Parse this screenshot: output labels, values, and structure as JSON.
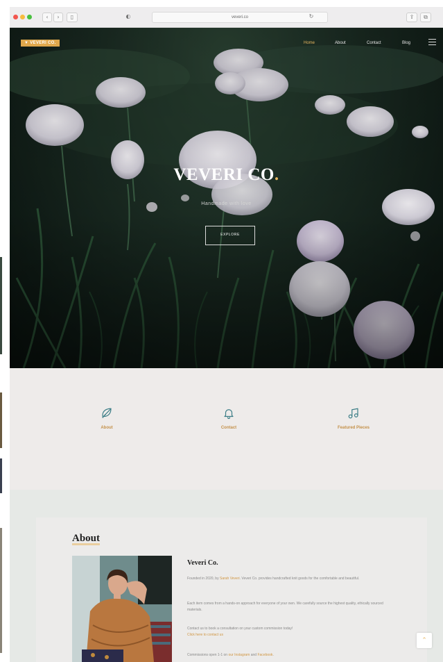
{
  "browser": {
    "url": "veveri.co",
    "colors": {
      "close": "#f2564f",
      "minimize": "#f7bb3e",
      "maximize": "#49c03f"
    },
    "icons": [
      "back-icon",
      "forward-icon",
      "sidebar-icon",
      "privacy-icon",
      "reload-icon",
      "share-icon",
      "tabs-icon"
    ]
  },
  "nav": {
    "logo": "VEVERI CO.",
    "items": [
      "Home",
      "About",
      "Contact",
      "Blog"
    ],
    "active_index": 0
  },
  "hero": {
    "title_main": "VEVERI",
    "title_tail": " CO",
    "title_dot": ".",
    "subtitle": "Handmade with love",
    "button": "EXPLORE"
  },
  "features": [
    {
      "icon": "leaf-icon",
      "label": "About"
    },
    {
      "icon": "bell-icon",
      "label": "Contact"
    },
    {
      "icon": "music-icon",
      "label": "Featured Pieces"
    }
  ],
  "about": {
    "heading": "About",
    "name": "Veveri Co.",
    "p1_before": "Founded in 2020, by ",
    "p1_link": "Sarah Veveri",
    "p1_after": ". Veveri Co. provides handcrafted knit goods for the comfortable and beautiful.",
    "p2": "Each item comes from a hands-on approach for everyone of your own. We carefully source the highest quality, ethically sourced materials.",
    "p3": "Contact us to book a consultation on your custom commission today!",
    "p3_link": "Click here to contact us",
    "p4_before": "Commissions open 1-1 on ",
    "p4_link1": "our Instagram",
    "p4_mid": " and ",
    "p4_link2": "Facebook",
    "p4_after": "."
  },
  "accent_color": "#e7b660",
  "icon_color": "#3b7d86"
}
